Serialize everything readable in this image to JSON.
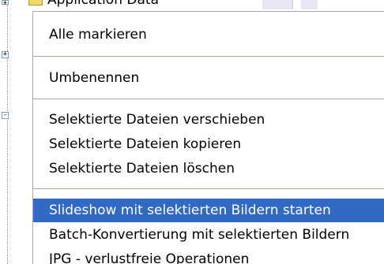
{
  "background": {
    "row_label": "Application Data",
    "folder_icon": "folder-icon",
    "toggle_symbols": [
      "+",
      "+",
      "-"
    ]
  },
  "menu": {
    "items": [
      {
        "label": "Alle markieren",
        "selected": false
      },
      {
        "label": "Umbenennen",
        "selected": false
      },
      {
        "label": "Selektierte Dateien verschieben",
        "selected": false
      },
      {
        "label": "Selektierte Dateien kopieren",
        "selected": false
      },
      {
        "label": "Selektierte Dateien löschen",
        "selected": false
      },
      {
        "label": "Slideshow mit selektierten Bildern starten",
        "selected": true
      },
      {
        "label": "Batch-Konvertierung mit selektierten Bildern",
        "selected": false
      },
      {
        "label": "JPG - verlustfreie Operationen",
        "selected": false
      }
    ]
  },
  "colors": {
    "selection_bg": "#316ac5",
    "selection_fg": "#ffffff",
    "separator": "#aca899"
  }
}
